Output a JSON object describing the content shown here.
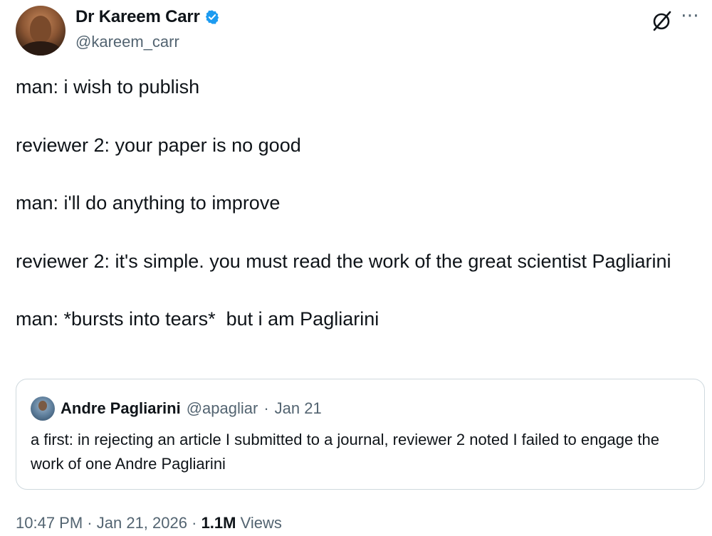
{
  "author": {
    "name": "Dr Kareem Carr",
    "handle": "@kareem_carr"
  },
  "tweet": {
    "lines": [
      "man: i wish to publish",
      "reviewer 2: your paper is no good",
      "man: i'll do anything to improve",
      "reviewer 2: it's simple. you must read the work of the great scientist Pagliarini",
      "man: *bursts into tears*  but i am Pagliarini"
    ]
  },
  "quote": {
    "name": "Andre Pagliarini",
    "handle": "@apagliar",
    "separator": "·",
    "date": "Jan 21",
    "text": "a first: in rejecting an article I submitted to a journal, reviewer 2 noted I failed to engage the work of one Andre Pagliarini"
  },
  "meta": {
    "time": "10:47 PM",
    "separator": "·",
    "date": "Jan 21, 2026",
    "separator2": "·",
    "views_count": "1.1M",
    "views_label": "Views"
  },
  "icons": {
    "verified": "verified-badge-icon",
    "grok": "grok-icon",
    "more": "more-icon"
  },
  "colors": {
    "accent": "#1d9bf0",
    "text_primary": "#0f1419",
    "text_secondary": "#536471",
    "border": "#cfd9de"
  }
}
